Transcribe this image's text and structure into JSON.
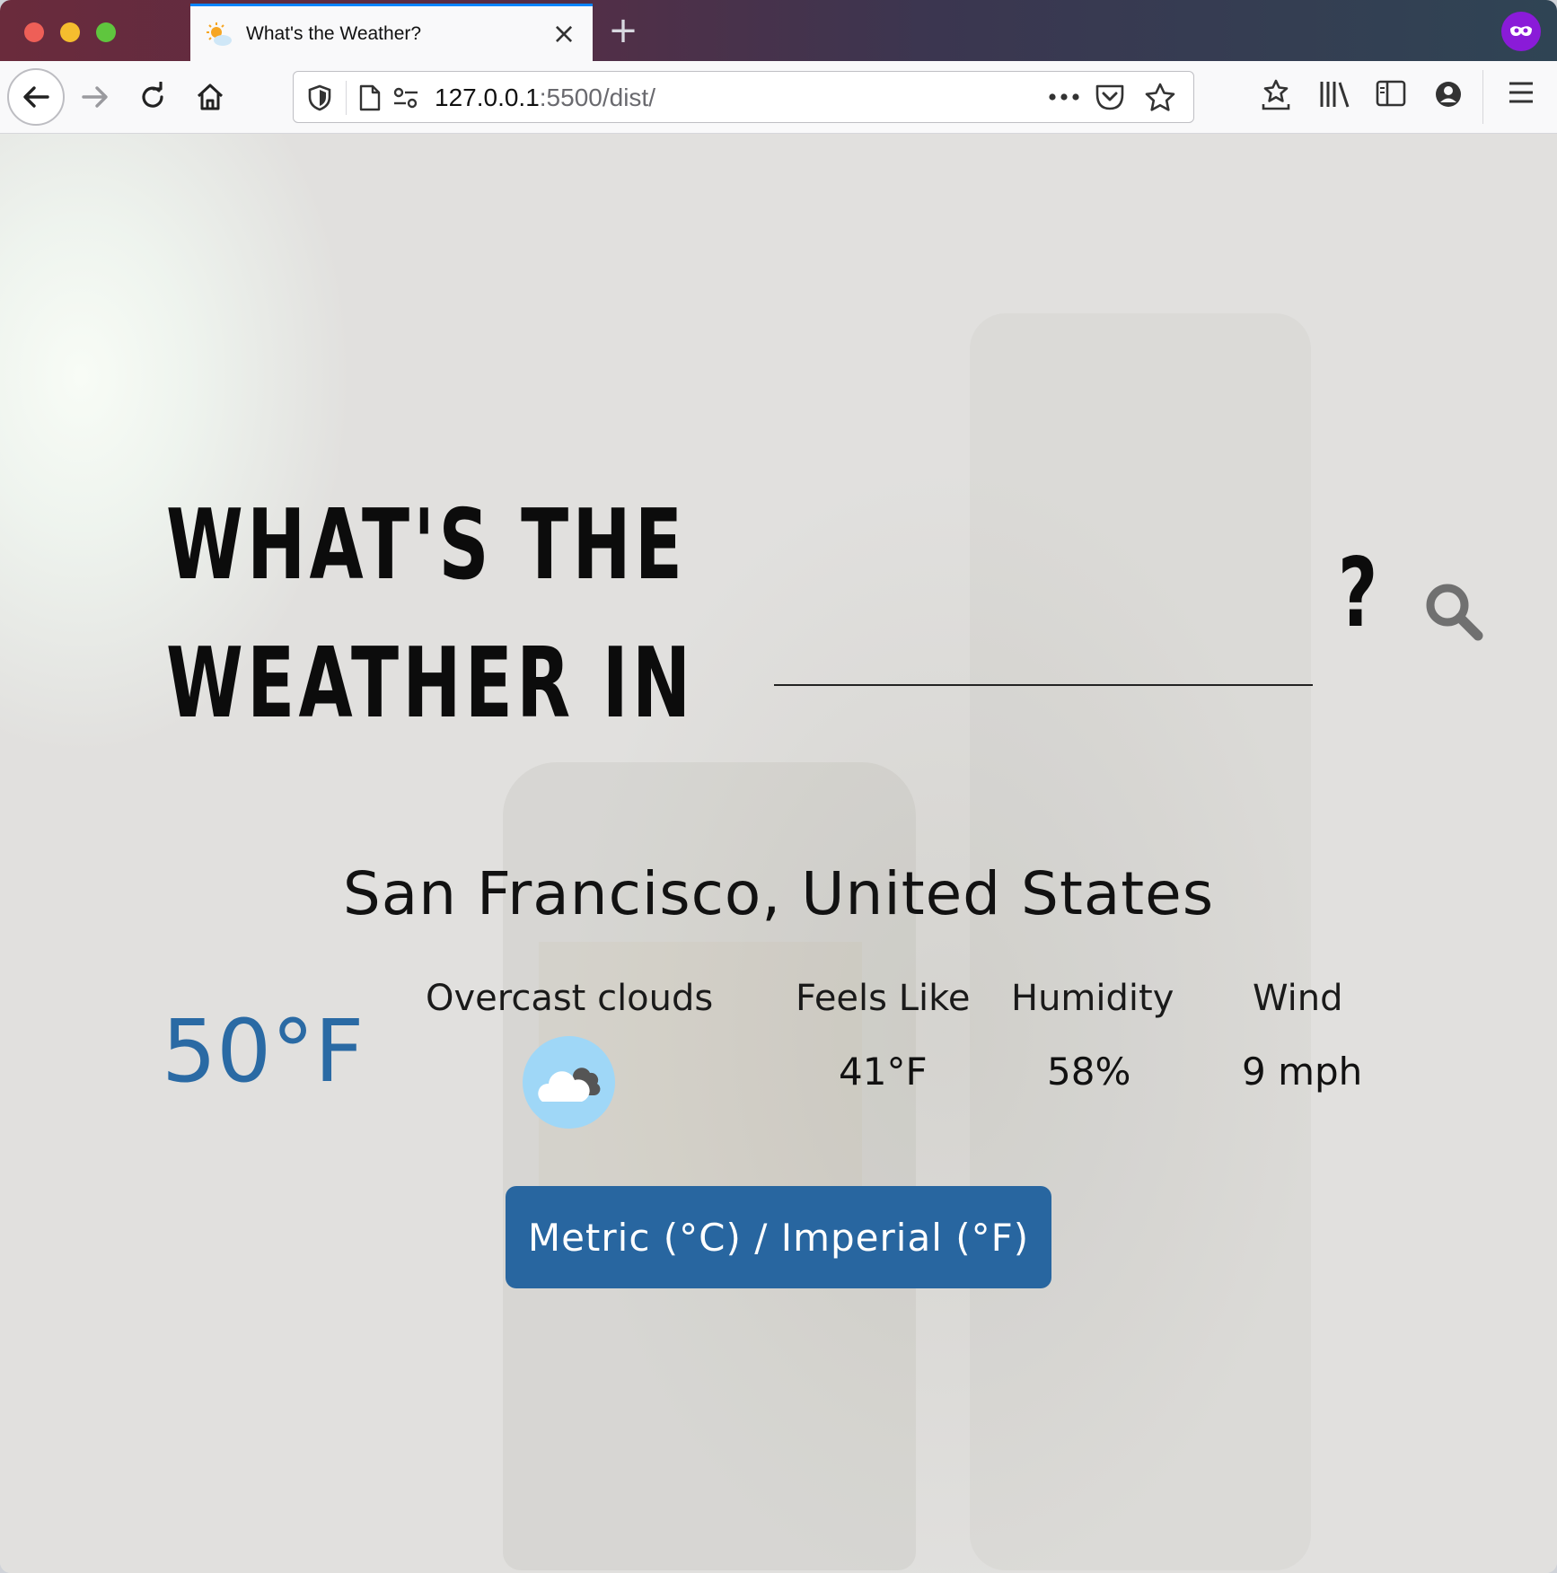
{
  "browser": {
    "tab": {
      "title": "What's the Weather?"
    },
    "url": {
      "host": "127.0.0.1",
      "rest": ":5500/dist/"
    }
  },
  "page": {
    "headline_line1": "WHAT'S THE",
    "headline_line2": "WEATHER IN",
    "city_input": {
      "value": "",
      "placeholder": ""
    },
    "question_mark": "?",
    "location": "San Francisco, United States",
    "temperature": "50°F",
    "condition": "Overcast clouds",
    "weather_icon": "overcast-cloud-icon",
    "stats": [
      {
        "label": "Feels Like",
        "value": "41°F"
      },
      {
        "label": "Humidity",
        "value": "58%"
      },
      {
        "label": "Wind",
        "value": "9 mph"
      }
    ],
    "unit_toggle_label": "Metric (°C) / Imperial (°F)"
  },
  "colors": {
    "accent_blue": "#2866a0",
    "temperature": "#2a6aa4",
    "icon_bg": "#9fd7f7"
  }
}
